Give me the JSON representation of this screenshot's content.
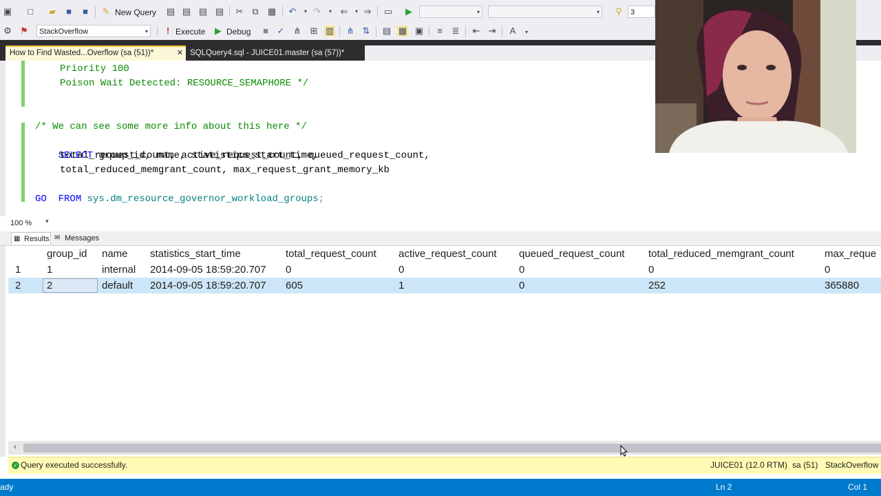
{
  "toolbar": {
    "new_query_label": "New Query",
    "database_combo": "StackOverflow",
    "execute_label": "Execute",
    "debug_label": "Debug",
    "combo3_value": "3"
  },
  "tabs": [
    {
      "label": "How to Find Wasted...Overflow (sa (51))*",
      "close": "✕"
    },
    {
      "label": "SQLQuery4.sql - JUICE01.master (sa (57))*"
    }
  ],
  "editor": {
    "lines": [
      "Priority 100",
      "Poison Wait Detected: RESOURCE_SEMAPHORE */",
      "",
      "",
      "/* We can see some more info about this here */",
      "SELECT",
      " group_id, name, statistics_start_time,",
      "total_request_count, active_request_count, queued_request_count,",
      "total_reduced_memgrant_count, max_request_grant_memory_kb",
      "FROM",
      "sys.dm_resource_governor_workload_groups",
      ";",
      "GO"
    ]
  },
  "zoom": {
    "value": "100 %"
  },
  "result_tabs": [
    "Results",
    "Messages"
  ],
  "grid": {
    "columns": [
      "group_id",
      "name",
      "statistics_start_time",
      "total_request_count",
      "active_request_count",
      "queued_request_count",
      "total_reduced_memgrant_count",
      "max_reque"
    ],
    "rows": [
      {
        "num": "1",
        "cells": [
          "1",
          "internal",
          "2014-09-05 18:59:20.707",
          "0",
          "0",
          "0",
          "0",
          "0"
        ]
      },
      {
        "num": "2",
        "cells": [
          "2",
          "default",
          "2014-09-05 18:59:20.707",
          "605",
          "1",
          "0",
          "252",
          "365880"
        ]
      }
    ],
    "selected_row": 2
  },
  "query_status": {
    "message": "Query executed successfully.",
    "server": "JUICE01 (12.0 RTM)",
    "user": "sa (51)",
    "database": "StackOverflow"
  },
  "statusbar": {
    "left": "ady",
    "ln": "Ln 2",
    "col": "Col 1"
  },
  "colors": {
    "accent": "#007acc",
    "selection": "#cde6f7",
    "status_yellow": "#fffbb4",
    "comment_green": "#0a8a00",
    "keyword_blue": "#0000ff"
  }
}
